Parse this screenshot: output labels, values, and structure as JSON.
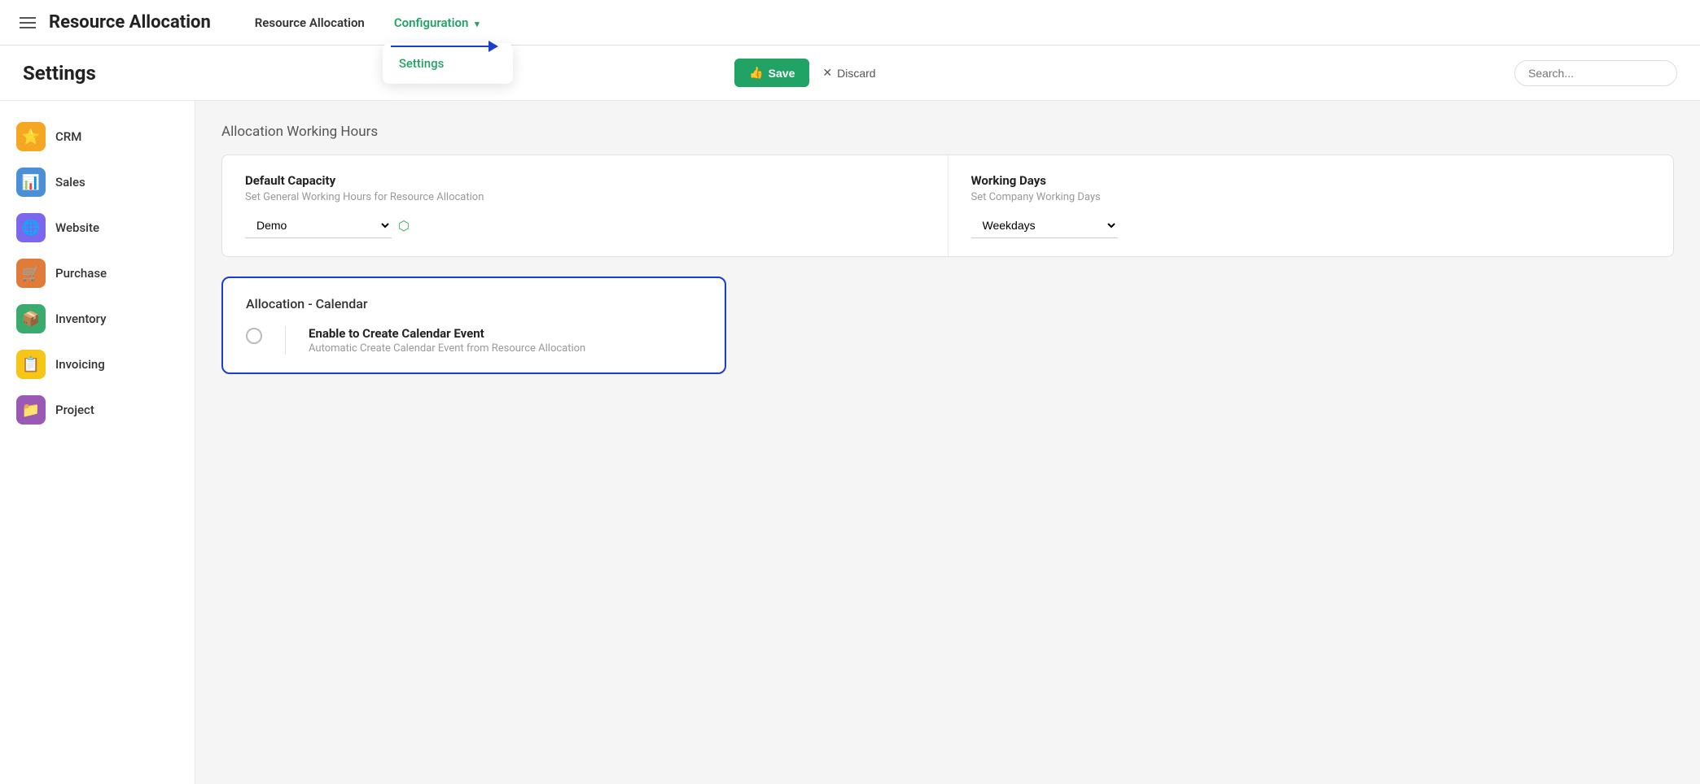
{
  "app": {
    "title": "Resource Allocation",
    "hamburger_label": "menu"
  },
  "topnav": {
    "links": [
      {
        "id": "resource-allocation",
        "label": "Resource Allocation",
        "active": false
      },
      {
        "id": "configuration",
        "label": "Configuration",
        "active": true,
        "chevron": "▾"
      }
    ]
  },
  "dropdown": {
    "items": [
      {
        "id": "settings",
        "label": "Settings"
      }
    ]
  },
  "arrow": {
    "visible": true
  },
  "settings_header": {
    "title": "Settings",
    "save_label": "Save",
    "discard_label": "Discard",
    "search_placeholder": "Search..."
  },
  "sidebar": {
    "items": [
      {
        "id": "crm",
        "label": "CRM",
        "icon": "⭐",
        "color_class": "icon-crm"
      },
      {
        "id": "sales",
        "label": "Sales",
        "icon": "📊",
        "color_class": "icon-sales"
      },
      {
        "id": "website",
        "label": "Website",
        "icon": "🌐",
        "color_class": "icon-website"
      },
      {
        "id": "purchase",
        "label": "Purchase",
        "icon": "🛒",
        "color_class": "icon-purchase"
      },
      {
        "id": "inventory",
        "label": "Inventory",
        "icon": "📦",
        "color_class": "icon-inventory"
      },
      {
        "id": "invoicing",
        "label": "Invoicing",
        "icon": "📋",
        "color_class": "icon-invoicing"
      },
      {
        "id": "project",
        "label": "Project",
        "icon": "📁",
        "color_class": "icon-project"
      }
    ]
  },
  "content": {
    "section_title": "Allocation Working Hours",
    "default_capacity": {
      "label": "Default Capacity",
      "description": "Set General Working Hours for Resource Allocation",
      "value": "Demo"
    },
    "working_days": {
      "label": "Working Days",
      "description": "Set Company Working Days",
      "value": "Weekdays"
    },
    "calendar_card": {
      "title": "Allocation - Calendar",
      "option_label": "Enable to Create Calendar Event",
      "option_desc": "Automatic Create Calendar Event from Resource Allocation"
    }
  }
}
